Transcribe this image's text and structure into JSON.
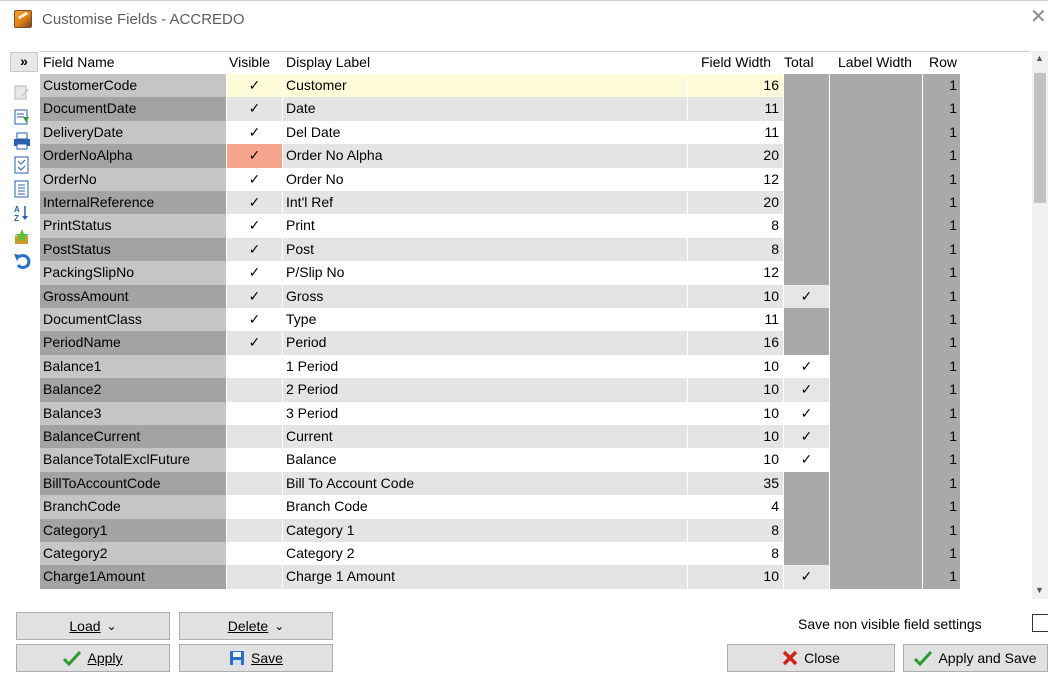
{
  "window": {
    "title": "Customise Fields - ACCREDO",
    "close_glyph": "✕"
  },
  "toolbar": {
    "expand_glyph": "»",
    "icons": [
      "edit-icon",
      "import-icon",
      "print-icon",
      "list-icon",
      "details-icon",
      "sort-az-icon",
      "favourites-icon",
      "undo-icon"
    ]
  },
  "grid": {
    "columns": {
      "name": "Field Name",
      "visible": "Visible",
      "label": "Display Label",
      "width": "Field Width",
      "total": "Total",
      "label_width": "Label Width",
      "row": "Row"
    },
    "check": "✓",
    "rows": [
      {
        "name": "CustomerCode",
        "visible": true,
        "label": "Customer",
        "width": "16",
        "total": false,
        "row": "1"
      },
      {
        "name": "DocumentDate",
        "visible": true,
        "label": "Date",
        "width": "11",
        "total": false,
        "row": "1"
      },
      {
        "name": "DeliveryDate",
        "visible": true,
        "label": "Del Date",
        "width": "11",
        "total": false,
        "row": "1"
      },
      {
        "name": "OrderNoAlpha",
        "visible": true,
        "label": "Order No Alpha",
        "width": "20",
        "total": false,
        "row": "1"
      },
      {
        "name": "OrderNo",
        "visible": true,
        "label": "Order No",
        "width": "12",
        "total": false,
        "row": "1"
      },
      {
        "name": "InternalReference",
        "visible": true,
        "label": "Int'l Ref",
        "width": "20",
        "total": false,
        "row": "1"
      },
      {
        "name": "PrintStatus",
        "visible": true,
        "label": "Print",
        "width": "8",
        "total": false,
        "row": "1"
      },
      {
        "name": "PostStatus",
        "visible": true,
        "label": "Post",
        "width": "8",
        "total": false,
        "row": "1"
      },
      {
        "name": "PackingSlipNo",
        "visible": true,
        "label": "P/Slip No",
        "width": "12",
        "total": false,
        "row": "1"
      },
      {
        "name": "GrossAmount",
        "visible": true,
        "label": "Gross",
        "width": "10",
        "total": true,
        "row": "1"
      },
      {
        "name": "DocumentClass",
        "visible": true,
        "label": "Type",
        "width": "11",
        "total": false,
        "row": "1"
      },
      {
        "name": "PeriodName",
        "visible": true,
        "label": "Period",
        "width": "16",
        "total": false,
        "row": "1"
      },
      {
        "name": "Balance1",
        "visible": false,
        "label": "1 Period",
        "width": "10",
        "total": true,
        "row": "1"
      },
      {
        "name": "Balance2",
        "visible": false,
        "label": "2 Period",
        "width": "10",
        "total": true,
        "row": "1"
      },
      {
        "name": "Balance3",
        "visible": false,
        "label": "3 Period",
        "width": "10",
        "total": true,
        "row": "1"
      },
      {
        "name": "BalanceCurrent",
        "visible": false,
        "label": "Current",
        "width": "10",
        "total": true,
        "row": "1"
      },
      {
        "name": "BalanceTotalExclFuture",
        "visible": false,
        "label": "Balance",
        "width": "10",
        "total": true,
        "row": "1"
      },
      {
        "name": "BillToAccountCode",
        "visible": false,
        "label": "Bill To Account Code",
        "width": "35",
        "total": false,
        "row": "1"
      },
      {
        "name": "BranchCode",
        "visible": false,
        "label": "Branch Code",
        "width": "4",
        "total": false,
        "row": "1"
      },
      {
        "name": "Category1",
        "visible": false,
        "label": "Category 1",
        "width": "8",
        "total": false,
        "row": "1"
      },
      {
        "name": "Category2",
        "visible": false,
        "label": "Category 2",
        "width": "8",
        "total": false,
        "row": "1"
      },
      {
        "name": "Charge1Amount",
        "visible": false,
        "label": "Charge 1 Amount",
        "width": "10",
        "total": true,
        "row": "1"
      }
    ]
  },
  "buttons": {
    "load": "Load",
    "delete": "Delete",
    "apply": "Apply",
    "save": "Save",
    "close": "Close",
    "apply_and_save": "Apply and Save",
    "dropdown_glyph": "⌄"
  },
  "options": {
    "save_non_visible": "Save non visible field settings"
  },
  "colors": {
    "accent_green": "#2e9b2e",
    "close_red": "#d0241a",
    "save_blue": "#2a6fc9",
    "highlight_orange": "#f5a48e",
    "active_row": "#fffbd8"
  }
}
